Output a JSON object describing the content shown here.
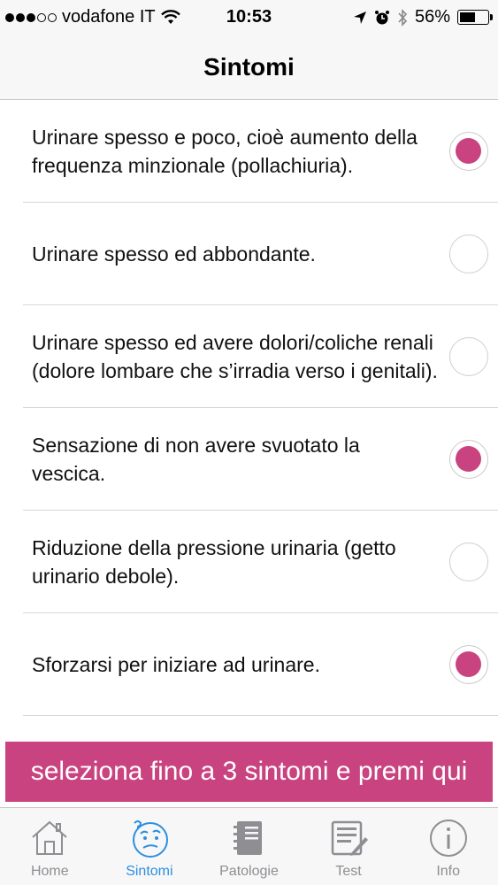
{
  "status_bar": {
    "carrier": "vodafone IT",
    "time": "10:53",
    "battery_percent": "56%",
    "battery_level": 0.56
  },
  "nav": {
    "title": "Sintomi"
  },
  "symptoms": [
    {
      "label": "Urinare spesso e poco, cioè aumento della frequenza minzionale (pollachiuria).",
      "selected": true
    },
    {
      "label": "Urinare spesso ed abbondante.",
      "selected": false
    },
    {
      "label": "Urinare spesso ed avere dolori/coliche renali (dolore lombare che s’irradia verso i genitali).",
      "selected": false
    },
    {
      "label": "Sensazione di non avere svuotato la vescica.",
      "selected": true
    },
    {
      "label": "Riduzione della pressione urinaria (getto urinario debole).",
      "selected": false
    },
    {
      "label": "Sforzarsi per iniziare ad urinare.",
      "selected": true
    }
  ],
  "cta": {
    "label": "seleziona fino a 3 sintomi e premi qui"
  },
  "tabs": [
    {
      "label": "Home",
      "icon": "house-icon",
      "active": false
    },
    {
      "label": "Sintomi",
      "icon": "confused-face-icon",
      "active": true
    },
    {
      "label": "Patologie",
      "icon": "notebook-icon",
      "active": false
    },
    {
      "label": "Test",
      "icon": "clipboard-pencil-icon",
      "active": false
    },
    {
      "label": "Info",
      "icon": "info-icon",
      "active": false
    }
  ],
  "colors": {
    "accent": "#c8437f",
    "tab_active": "#2d8fe0",
    "tab_inactive": "#8e8e93"
  }
}
